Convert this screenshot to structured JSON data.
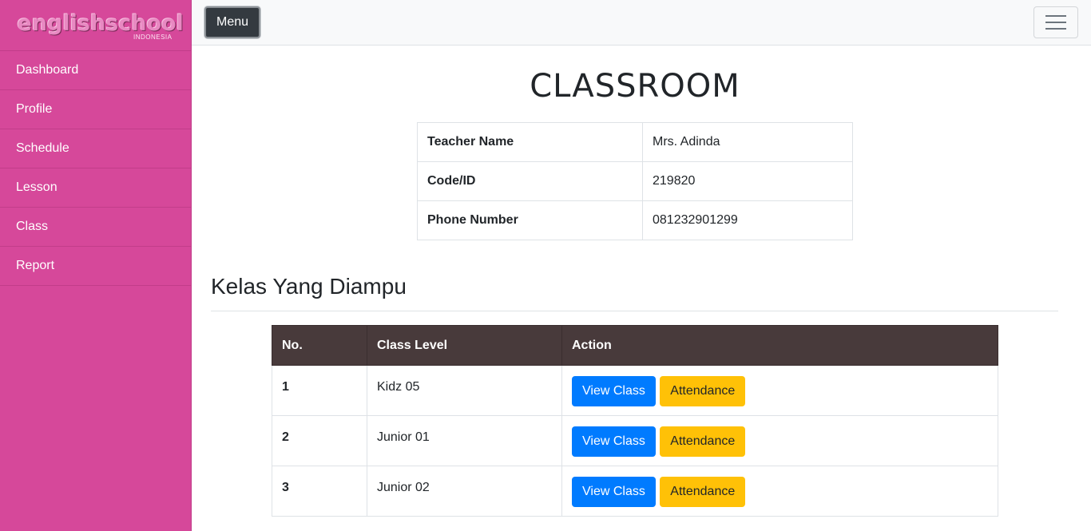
{
  "brand": {
    "name": "englishschool",
    "sub": "INDONESIA"
  },
  "sidebar": {
    "items": [
      {
        "label": "Dashboard"
      },
      {
        "label": "Profile"
      },
      {
        "label": "Schedule"
      },
      {
        "label": "Lesson"
      },
      {
        "label": "Class"
      },
      {
        "label": "Report"
      }
    ]
  },
  "topbar": {
    "menu_label": "Menu",
    "toggle_icon": "hamburger-icon"
  },
  "page": {
    "title": "CLASSROOM"
  },
  "teacher_info": [
    {
      "key": "Teacher Name",
      "value": "Mrs. Adinda"
    },
    {
      "key": "Code/ID",
      "value": "219820"
    },
    {
      "key": "Phone Number",
      "value": "081232901299"
    }
  ],
  "section": {
    "title": "Kelas Yang Diampu"
  },
  "class_table": {
    "headers": [
      "No.",
      "Class Level",
      "Action"
    ],
    "rows": [
      {
        "no": "1",
        "level": "Kidz 05",
        "view": "View Class",
        "attendance": "Attendance"
      },
      {
        "no": "2",
        "level": "Junior 01",
        "view": "View Class",
        "attendance": "Attendance"
      },
      {
        "no": "3",
        "level": "Junior 02",
        "view": "View Class",
        "attendance": "Attendance"
      }
    ]
  },
  "colors": {
    "sidebar": "#d6489a",
    "table_header": "#483a3b",
    "primary": "#007bff",
    "warning": "#ffc107"
  }
}
